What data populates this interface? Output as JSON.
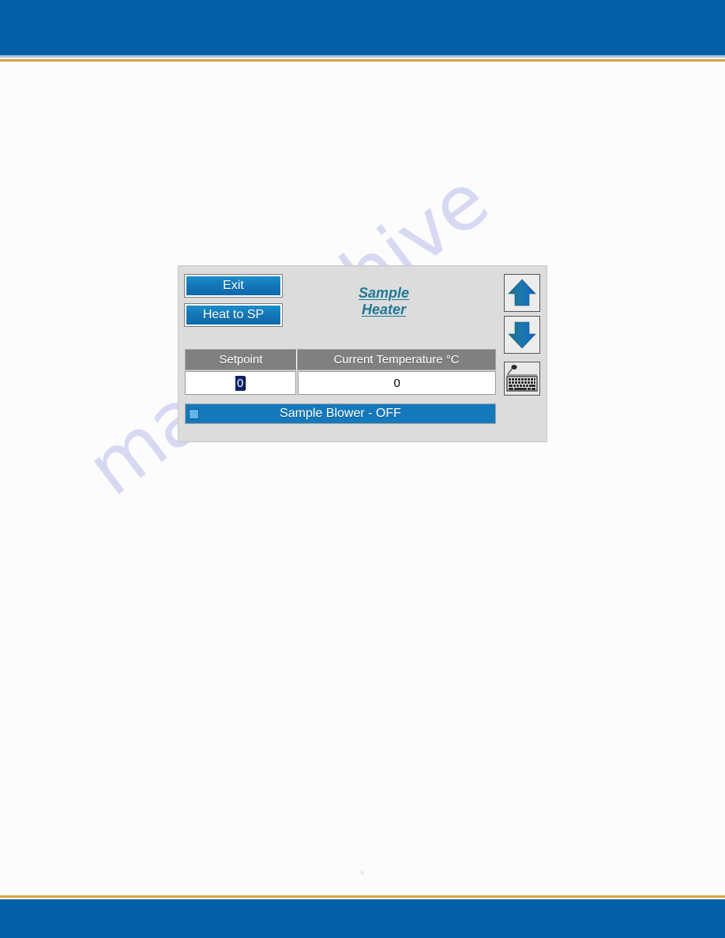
{
  "document": {
    "page_number": "6",
    "watermark": "manualshive"
  },
  "theme": {
    "band_blue": "#0360a8",
    "rule_gold": "#d9a23c",
    "button_blue": "#1378b8",
    "header_gray": "#808080",
    "title_teal": "#1f7896",
    "selection_blue": "#0a246a",
    "blower_blue": "#1479bb",
    "panel_gray": "#dcdcdc"
  },
  "hmi": {
    "title_line1": "Sample",
    "title_line2": "Heater",
    "buttons": {
      "exit": "Exit",
      "heat_to_sp": "Heat to SP"
    },
    "table": {
      "headers": [
        "Setpoint",
        "Current Temperature  °C"
      ],
      "values": [
        "0",
        "0"
      ],
      "setpoint_selected": true
    },
    "blower": {
      "label": "Sample Blower - OFF",
      "checked": false
    },
    "icons": {
      "up": "arrow-up-icon",
      "down": "arrow-down-icon",
      "keyboard": "keyboard-icon"
    }
  }
}
